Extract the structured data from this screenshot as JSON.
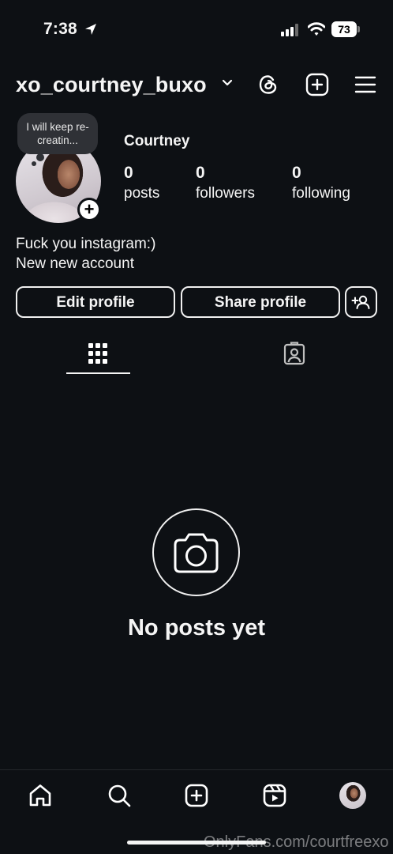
{
  "status_bar": {
    "time": "7:38",
    "battery": "73"
  },
  "header": {
    "username": "xo_courtney_buxo"
  },
  "profile": {
    "note": "I will keep re-creatin...",
    "display_name": "Courtney",
    "stats": [
      {
        "count": "0",
        "label": "posts"
      },
      {
        "count": "0",
        "label": "followers"
      },
      {
        "count": "0",
        "label": "following"
      }
    ],
    "bio_line1": "Fuck you instagram:)",
    "bio_line2": "New new account"
  },
  "actions": {
    "edit_profile": "Edit profile",
    "share_profile": "Share profile"
  },
  "empty_state": {
    "title": "No posts yet"
  },
  "watermark": "OnlyFans.com/courtfreexo"
}
